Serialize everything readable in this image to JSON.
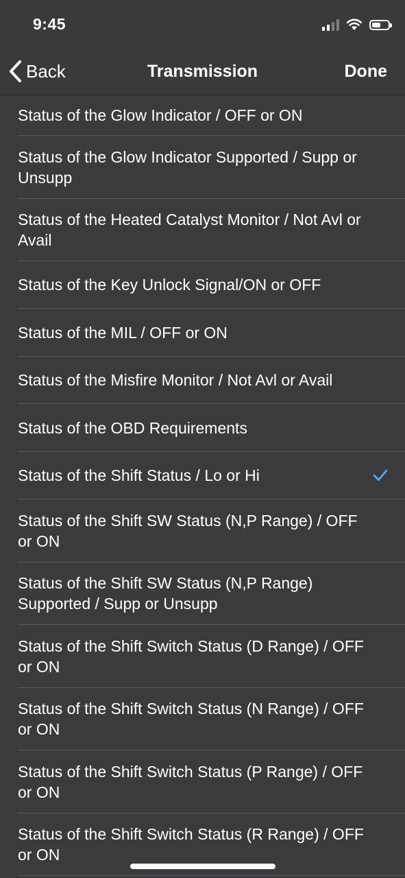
{
  "status_bar": {
    "time": "9:45",
    "battery_level": 0.55
  },
  "nav": {
    "back_label": "Back",
    "title": "Transmission",
    "done_label": "Done"
  },
  "list": {
    "items": [
      {
        "label": "Status of the Glow Indicator / OFF or ON",
        "selected": false
      },
      {
        "label": "Status of the Glow Indicator Supported / Supp or Unsupp",
        "selected": false
      },
      {
        "label": "Status of the Heated Catalyst Monitor / Not Avl or Avail",
        "selected": false
      },
      {
        "label": "Status of the Key Unlock Signal/ON or OFF",
        "selected": false
      },
      {
        "label": "Status of the MIL / OFF or ON",
        "selected": false
      },
      {
        "label": "Status of the Misfire Monitor / Not Avl or Avail",
        "selected": false
      },
      {
        "label": "Status of the OBD Requirements",
        "selected": false
      },
      {
        "label": "Status of the Shift Status / Lo or Hi",
        "selected": true
      },
      {
        "label": "Status of the Shift SW Status (N,P Range) / OFF or ON",
        "selected": false
      },
      {
        "label": "Status of the Shift SW Status (N,P Range) Supported / Supp or Unsupp",
        "selected": false
      },
      {
        "label": "Status of the Shift Switch Status (D Range) / OFF or ON",
        "selected": false
      },
      {
        "label": "Status of the Shift Switch Status (N Range) / OFF or ON",
        "selected": false
      },
      {
        "label": "Status of the Shift Switch Status (P Range) / OFF or ON",
        "selected": false
      },
      {
        "label": "Status of the Shift Switch Status (R Range) / OFF or ON",
        "selected": false
      }
    ]
  },
  "colors": {
    "background": "#3b3b3d",
    "accent": "#5aa8f0",
    "separator": "#5a5a5c"
  }
}
